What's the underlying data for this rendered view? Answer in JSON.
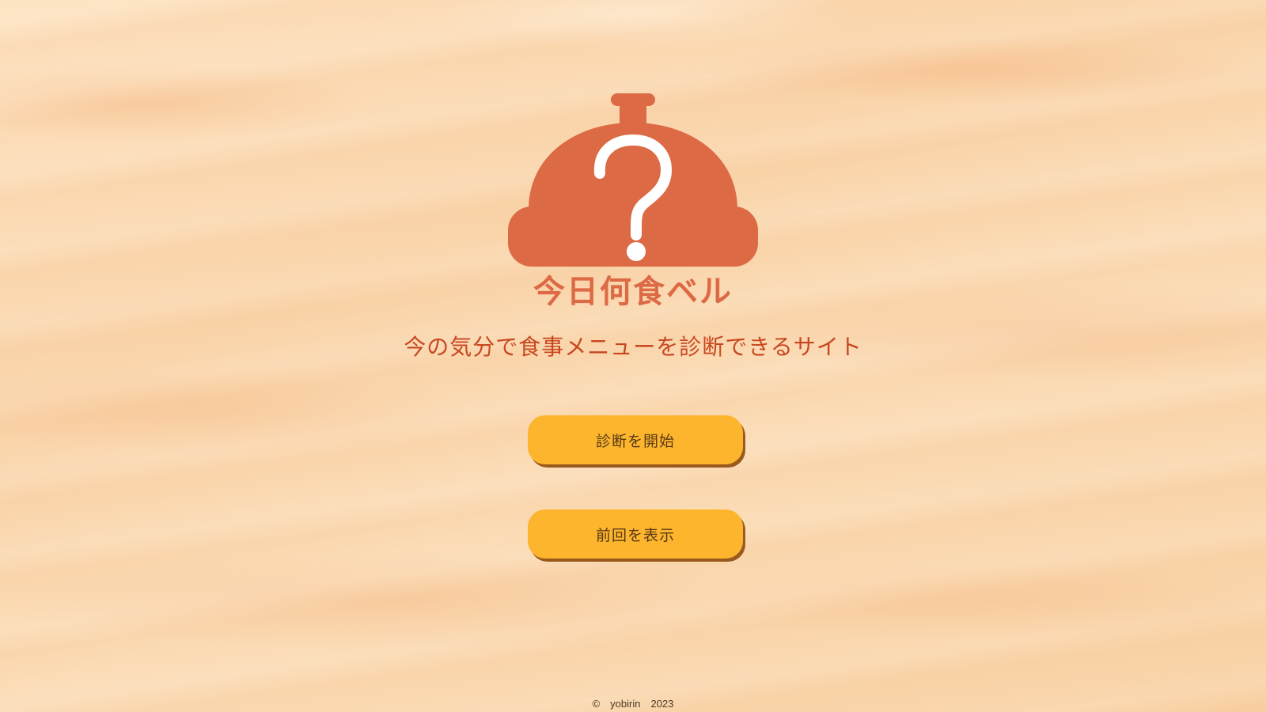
{
  "brand": {
    "site_name": "今日何食ベル",
    "logo_icon": "bell-question-icon",
    "colors": {
      "logo": "#dc6a45",
      "title_text": "#dc6a45",
      "tagline_text": "#c8471f",
      "button_bg": "#fdb52e"
    }
  },
  "hero": {
    "tagline": "今の気分で食事メニューを診断できるサイト"
  },
  "actions": {
    "start_label": "診断を開始",
    "previous_label": "前回を表示"
  },
  "footer": {
    "copyright": "©　yobirin　2023"
  }
}
